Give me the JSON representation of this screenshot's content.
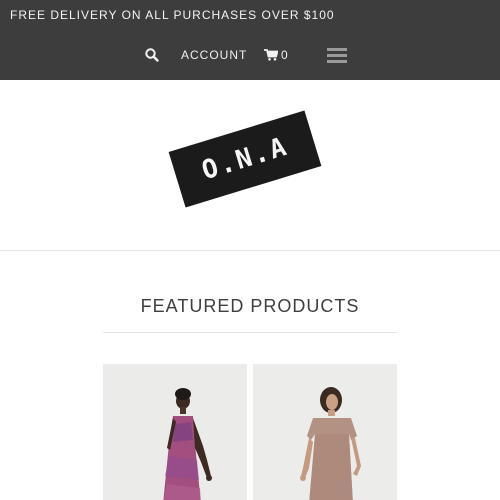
{
  "promo_banner": {
    "text": "FREE DELIVERY ON ALL PURCHASES OVER $100"
  },
  "nav": {
    "search_icon": "search-icon",
    "account_label": "ACCOUNT",
    "cart_icon": "cart-icon",
    "cart_count": "0",
    "menu_icon": "hamburger-menu-icon"
  },
  "logo": {
    "text": "O.N.A"
  },
  "featured": {
    "title": "FEATURED PRODUCTS",
    "products": [
      {
        "image": "pink-patterned-slip-dress-photo"
      },
      {
        "image": "beige-short-sleeve-dress-photo"
      }
    ]
  },
  "colors": {
    "topbar": "#3d3d3d",
    "logo_block": "#1b1b1b",
    "title_text": "#3e3e3e"
  }
}
